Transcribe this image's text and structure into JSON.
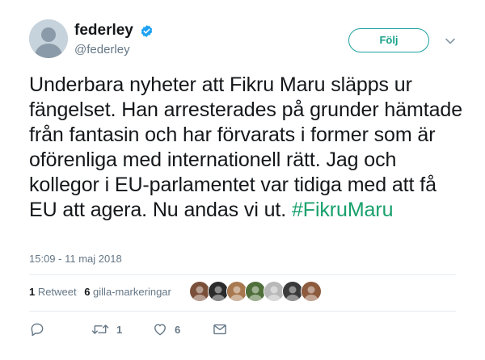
{
  "user": {
    "display_name": "federley",
    "handle": "@federley",
    "verified": true
  },
  "follow_button": {
    "label": "Följ"
  },
  "tweet": {
    "text": "Underbara nyheter att Fikru Maru släpps ur fängelset. Han arresterades på grunder hämtade från fantasin och har förvarats i former som är oförenliga med internationell rätt. Jag och kollegor i EU-parlamentet var tidiga med att få EU att agera. Nu andas vi ut.",
    "hashtag": "#FikruMaru",
    "timestamp": "15:09 - 11 maj 2018"
  },
  "stats": {
    "retweets_count": "1",
    "retweets_label": "Retweet",
    "likes_count": "6",
    "likes_label": "gilla-markeringar"
  },
  "liker_avatars": [
    {
      "name": "liker-1",
      "color": "#7a4f3a"
    },
    {
      "name": "liker-2",
      "color": "#2b2b2b"
    },
    {
      "name": "liker-3",
      "color": "#a8784e"
    },
    {
      "name": "liker-4",
      "color": "#4f6f3a"
    },
    {
      "name": "liker-5",
      "color": "#b8b8b8"
    },
    {
      "name": "liker-6",
      "color": "#3a3a3a"
    },
    {
      "name": "liker-7",
      "color": "#8c5a3c"
    }
  ],
  "actions": {
    "reply_count": "",
    "retweet_count": "1",
    "like_count": "6"
  },
  "colors": {
    "accent": "#1da1f2",
    "hashtag": "#18a06c",
    "muted": "#657786",
    "text": "#14171a"
  }
}
